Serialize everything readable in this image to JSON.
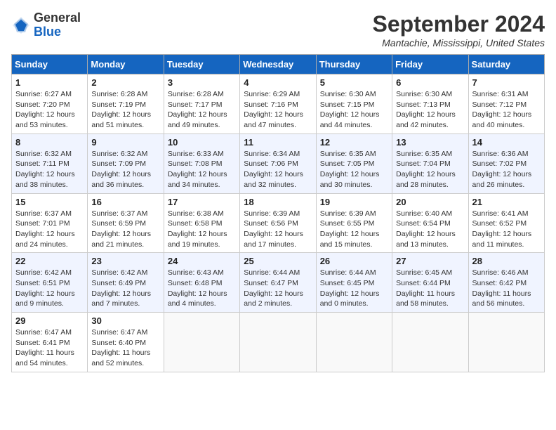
{
  "header": {
    "logo_general": "General",
    "logo_blue": "Blue",
    "month_title": "September 2024",
    "location": "Mantachie, Mississippi, United States"
  },
  "days_of_week": [
    "Sunday",
    "Monday",
    "Tuesday",
    "Wednesday",
    "Thursday",
    "Friday",
    "Saturday"
  ],
  "weeks": [
    [
      {
        "day": "1",
        "sunrise": "6:27 AM",
        "sunset": "7:20 PM",
        "daylight": "12 hours and 53 minutes."
      },
      {
        "day": "2",
        "sunrise": "6:28 AM",
        "sunset": "7:19 PM",
        "daylight": "12 hours and 51 minutes."
      },
      {
        "day": "3",
        "sunrise": "6:28 AM",
        "sunset": "7:17 PM",
        "daylight": "12 hours and 49 minutes."
      },
      {
        "day": "4",
        "sunrise": "6:29 AM",
        "sunset": "7:16 PM",
        "daylight": "12 hours and 47 minutes."
      },
      {
        "day": "5",
        "sunrise": "6:30 AM",
        "sunset": "7:15 PM",
        "daylight": "12 hours and 44 minutes."
      },
      {
        "day": "6",
        "sunrise": "6:30 AM",
        "sunset": "7:13 PM",
        "daylight": "12 hours and 42 minutes."
      },
      {
        "day": "7",
        "sunrise": "6:31 AM",
        "sunset": "7:12 PM",
        "daylight": "12 hours and 40 minutes."
      }
    ],
    [
      {
        "day": "8",
        "sunrise": "6:32 AM",
        "sunset": "7:11 PM",
        "daylight": "12 hours and 38 minutes."
      },
      {
        "day": "9",
        "sunrise": "6:32 AM",
        "sunset": "7:09 PM",
        "daylight": "12 hours and 36 minutes."
      },
      {
        "day": "10",
        "sunrise": "6:33 AM",
        "sunset": "7:08 PM",
        "daylight": "12 hours and 34 minutes."
      },
      {
        "day": "11",
        "sunrise": "6:34 AM",
        "sunset": "7:06 PM",
        "daylight": "12 hours and 32 minutes."
      },
      {
        "day": "12",
        "sunrise": "6:35 AM",
        "sunset": "7:05 PM",
        "daylight": "12 hours and 30 minutes."
      },
      {
        "day": "13",
        "sunrise": "6:35 AM",
        "sunset": "7:04 PM",
        "daylight": "12 hours and 28 minutes."
      },
      {
        "day": "14",
        "sunrise": "6:36 AM",
        "sunset": "7:02 PM",
        "daylight": "12 hours and 26 minutes."
      }
    ],
    [
      {
        "day": "15",
        "sunrise": "6:37 AM",
        "sunset": "7:01 PM",
        "daylight": "12 hours and 24 minutes."
      },
      {
        "day": "16",
        "sunrise": "6:37 AM",
        "sunset": "6:59 PM",
        "daylight": "12 hours and 21 minutes."
      },
      {
        "day": "17",
        "sunrise": "6:38 AM",
        "sunset": "6:58 PM",
        "daylight": "12 hours and 19 minutes."
      },
      {
        "day": "18",
        "sunrise": "6:39 AM",
        "sunset": "6:56 PM",
        "daylight": "12 hours and 17 minutes."
      },
      {
        "day": "19",
        "sunrise": "6:39 AM",
        "sunset": "6:55 PM",
        "daylight": "12 hours and 15 minutes."
      },
      {
        "day": "20",
        "sunrise": "6:40 AM",
        "sunset": "6:54 PM",
        "daylight": "12 hours and 13 minutes."
      },
      {
        "day": "21",
        "sunrise": "6:41 AM",
        "sunset": "6:52 PM",
        "daylight": "12 hours and 11 minutes."
      }
    ],
    [
      {
        "day": "22",
        "sunrise": "6:42 AM",
        "sunset": "6:51 PM",
        "daylight": "12 hours and 9 minutes."
      },
      {
        "day": "23",
        "sunrise": "6:42 AM",
        "sunset": "6:49 PM",
        "daylight": "12 hours and 7 minutes."
      },
      {
        "day": "24",
        "sunrise": "6:43 AM",
        "sunset": "6:48 PM",
        "daylight": "12 hours and 4 minutes."
      },
      {
        "day": "25",
        "sunrise": "6:44 AM",
        "sunset": "6:47 PM",
        "daylight": "12 hours and 2 minutes."
      },
      {
        "day": "26",
        "sunrise": "6:44 AM",
        "sunset": "6:45 PM",
        "daylight": "12 hours and 0 minutes."
      },
      {
        "day": "27",
        "sunrise": "6:45 AM",
        "sunset": "6:44 PM",
        "daylight": "11 hours and 58 minutes."
      },
      {
        "day": "28",
        "sunrise": "6:46 AM",
        "sunset": "6:42 PM",
        "daylight": "11 hours and 56 minutes."
      }
    ],
    [
      {
        "day": "29",
        "sunrise": "6:47 AM",
        "sunset": "6:41 PM",
        "daylight": "11 hours and 54 minutes."
      },
      {
        "day": "30",
        "sunrise": "6:47 AM",
        "sunset": "6:40 PM",
        "daylight": "11 hours and 52 minutes."
      },
      null,
      null,
      null,
      null,
      null
    ]
  ]
}
